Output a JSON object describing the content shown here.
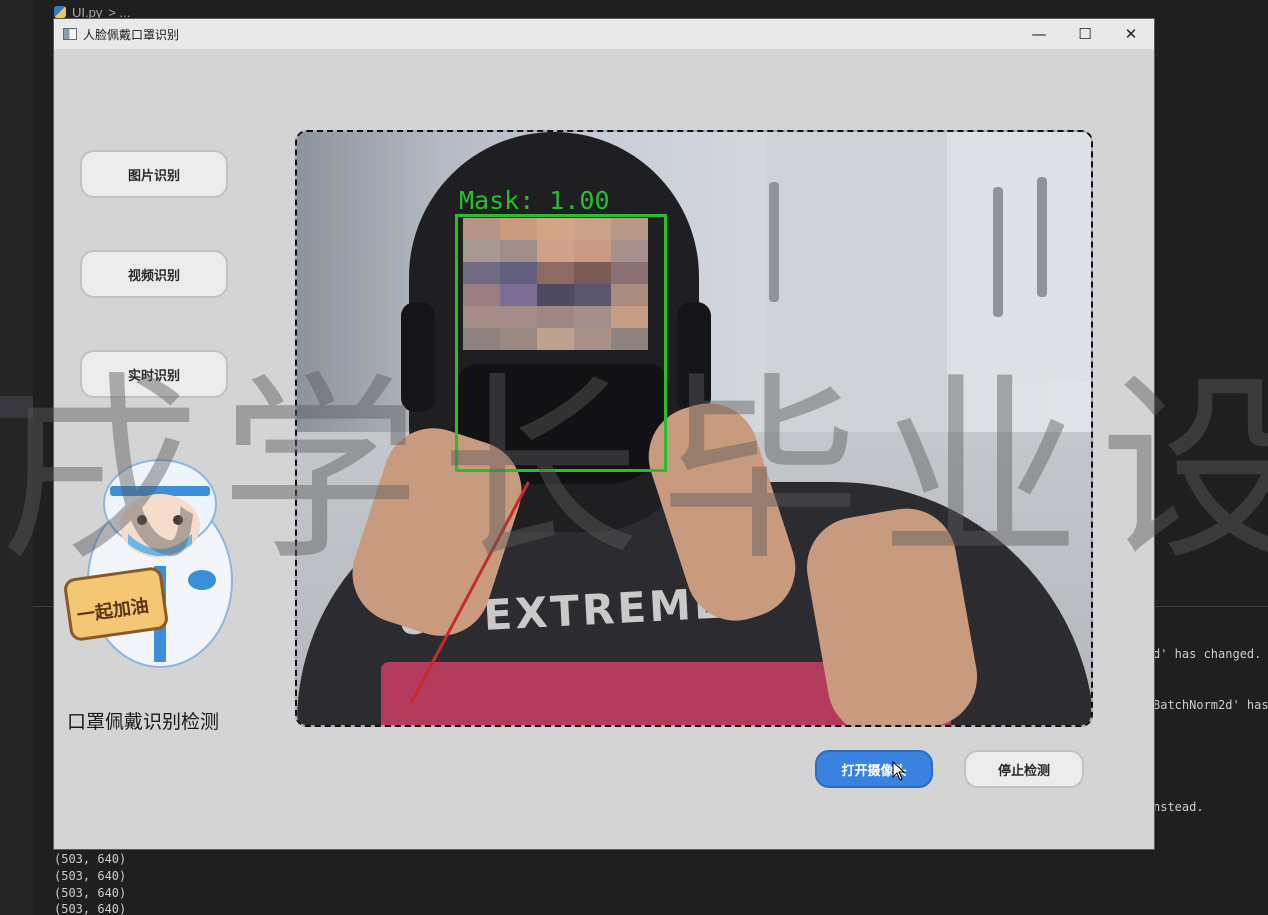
{
  "ide": {
    "breadcrumb_file": "UI.py",
    "breadcrumb_rest": "> ...",
    "output_lines": [
      "d' has changed. y",
      "BatchNorm2d' has",
      "nstead."
    ],
    "log_lines": [
      "(503, 640)",
      "(503, 640)",
      "(503, 640)",
      "(503, 640)"
    ]
  },
  "window": {
    "title": "人脸佩戴口罩识别",
    "controls": {
      "minimize": "—",
      "maximize": "☐",
      "close": "✕"
    }
  },
  "sidebar": {
    "buttons": [
      {
        "label": "图片识别"
      },
      {
        "label": "视频识别"
      },
      {
        "label": "实时识别"
      }
    ],
    "mascot_sign": "一起加油",
    "caption": "口罩佩戴识别检测"
  },
  "video": {
    "detection_label": "Mask: 1.00",
    "box_color": "#22c12c",
    "shirt_text": "UE EXTREME"
  },
  "actions": {
    "open_camera": "打开摄像头",
    "stop_detection": "停止检测"
  },
  "watermark": "戌学长毕业设",
  "colors": {
    "accent": "#3a82e0",
    "window_bg": "#d4d4d4",
    "ide_bg": "#1f1f1f"
  }
}
